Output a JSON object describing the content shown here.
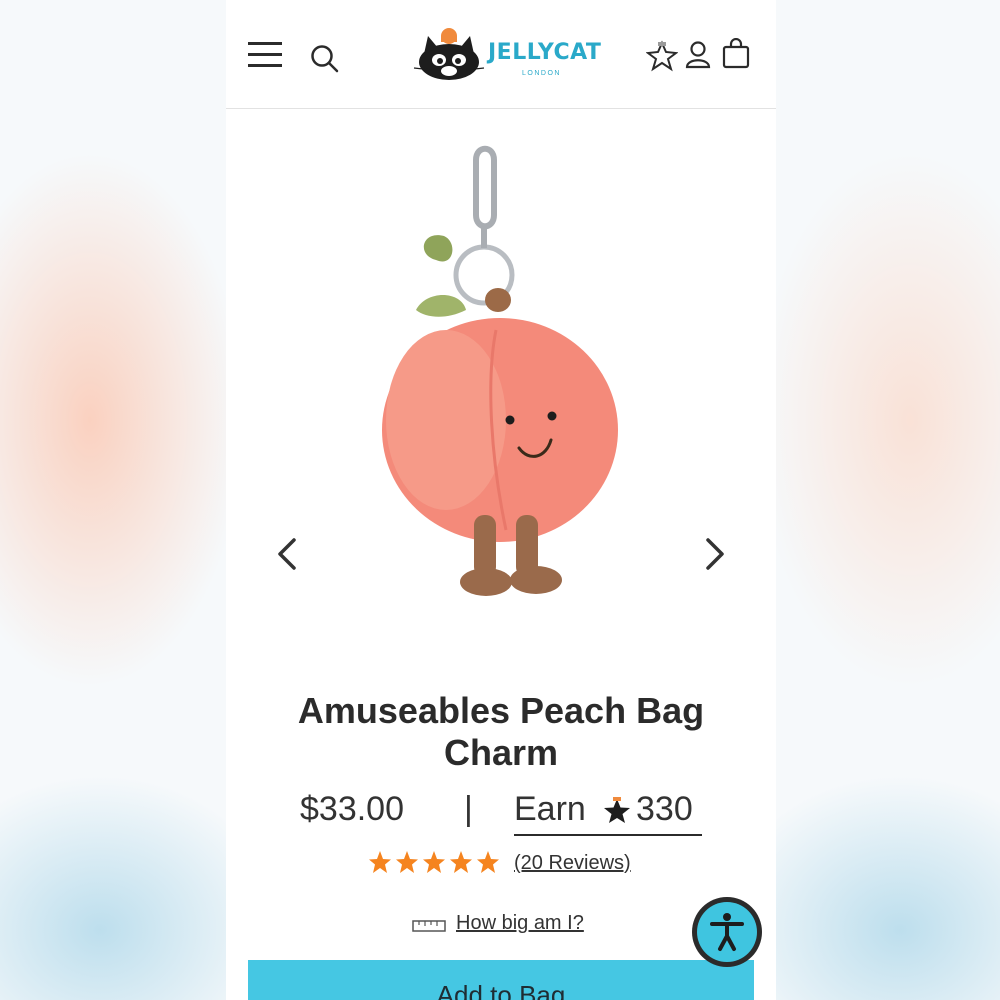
{
  "header": {
    "logo_text": "JELLYCAT",
    "logo_sub": "LONDON",
    "icons": [
      "menu-icon",
      "search-icon",
      "rewards-star-icon",
      "account-icon",
      "bag-icon"
    ]
  },
  "product": {
    "title": "Amuseables Peach Bag Charm",
    "price": "$33.00",
    "divider": "|",
    "earn_label": "Earn",
    "earn_points": "330",
    "rating_stars": 5,
    "reviews": "(20 Reviews)",
    "size_link": "How big am I?",
    "add_button": "Add to Bag"
  },
  "colors": {
    "accent": "#45c7e3",
    "star": "#f5841f",
    "logo": "#2aa9c9",
    "peach": "#f48a7a"
  }
}
